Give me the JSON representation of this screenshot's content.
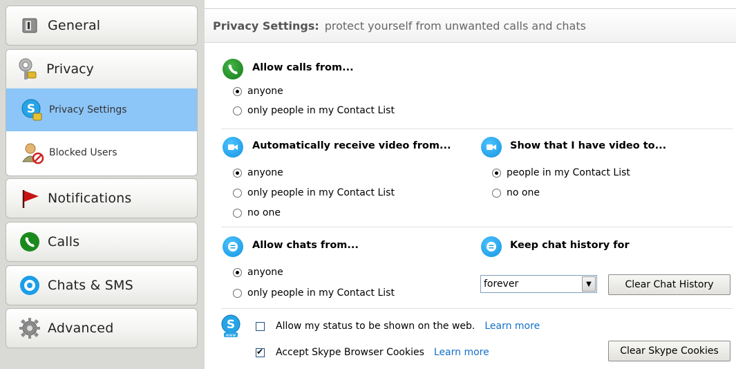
{
  "sidebar": {
    "general": "General",
    "privacy": "Privacy",
    "privacy_settings": "Privacy Settings",
    "blocked_users": "Blocked Users",
    "notifications": "Notifications",
    "calls": "Calls",
    "chats_sms": "Chats & SMS",
    "advanced": "Advanced",
    "selected_item": "Privacy Settings"
  },
  "header": {
    "title": "Privacy Settings:",
    "subtitle": "protect yourself from unwanted calls and chats"
  },
  "calls": {
    "title": "Allow calls from...",
    "options": [
      "anyone",
      "only people in my Contact List"
    ],
    "selected": "anyone"
  },
  "video_receive": {
    "title": "Automatically receive video from...",
    "options": [
      "anyone",
      "only people in my Contact List",
      "no one"
    ],
    "selected": "anyone"
  },
  "video_show": {
    "title": "Show that I have video to...",
    "options": [
      "people in my Contact List",
      "no one"
    ],
    "selected": "people in my Contact List"
  },
  "chats": {
    "title": "Allow chats from...",
    "options": [
      "anyone",
      "only people in my Contact List"
    ],
    "selected": "anyone"
  },
  "history": {
    "title": "Keep chat history for",
    "value": "forever",
    "clear_button": "Clear Chat History"
  },
  "web": {
    "status_label": "Allow my status to be shown on the web.",
    "status_checked": false,
    "cookies_label": "Accept Skype Browser Cookies",
    "cookies_checked": true,
    "learn_more": "Learn more",
    "clear_cookies_button": "Clear Skype Cookies"
  },
  "colors": {
    "selected_bg": "#8cc5f7",
    "link": "#1370c8",
    "green_icon": "#1a8a1c",
    "blue_icon": "#1c9ee8"
  }
}
